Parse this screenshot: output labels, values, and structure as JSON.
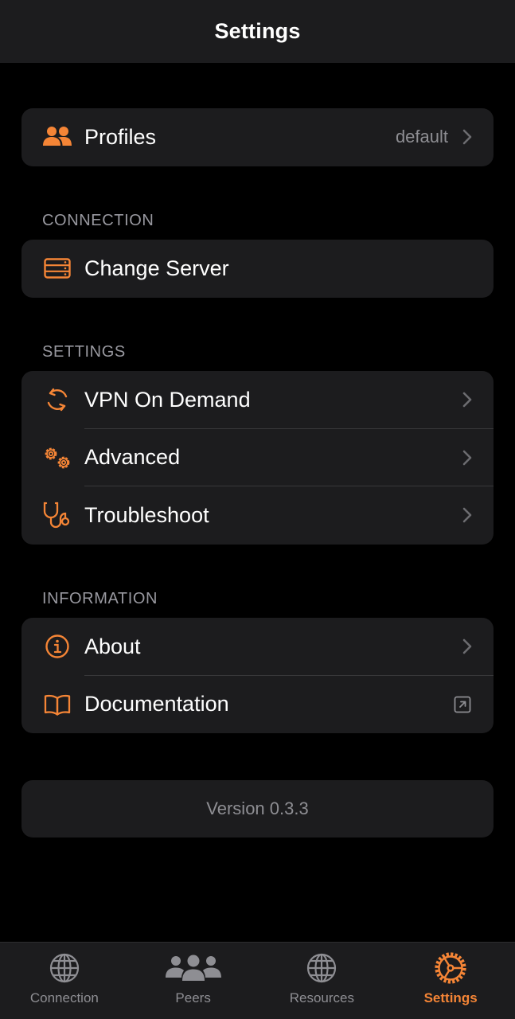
{
  "header": {
    "title": "Settings"
  },
  "profiles": {
    "label": "Profiles",
    "value": "default",
    "icon": "people-icon"
  },
  "sections": {
    "connection": "CONNECTION",
    "settings": "SETTINGS",
    "information": "INFORMATION"
  },
  "connection_items": [
    {
      "label": "Change Server",
      "icon": "server-icon"
    }
  ],
  "settings_items": [
    {
      "label": "VPN On Demand",
      "icon": "refresh-icon"
    },
    {
      "label": "Advanced",
      "icon": "gears-icon"
    },
    {
      "label": "Troubleshoot",
      "icon": "stethoscope-icon"
    }
  ],
  "information_items": [
    {
      "label": "About",
      "icon": "info-icon"
    },
    {
      "label": "Documentation",
      "icon": "book-icon"
    }
  ],
  "version": "Version 0.3.3",
  "tabbar": {
    "tabs": [
      {
        "label": "Connection",
        "icon": "globe-icon"
      },
      {
        "label": "Peers",
        "icon": "people-group-icon"
      },
      {
        "label": "Resources",
        "icon": "globe-icon"
      },
      {
        "label": "Settings",
        "icon": "settings-gear-icon",
        "active": true
      }
    ]
  },
  "colors": {
    "accent": "#f58536",
    "background": "#000000",
    "card": "#1c1c1e",
    "secondary_text": "#8e8e93"
  }
}
